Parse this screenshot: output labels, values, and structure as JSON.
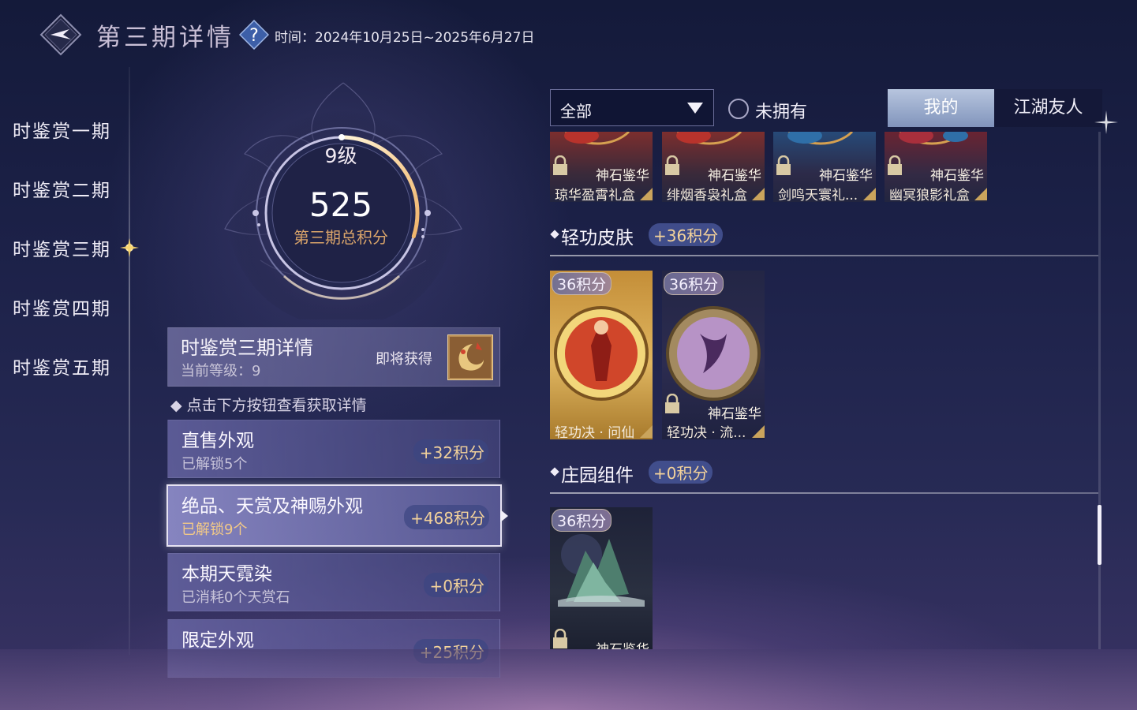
{
  "header": {
    "title": "第三期详情",
    "period_label": "时间：",
    "period_value": "2024年10月25日~2025年6月27日",
    "back_icon": "back-arrow-icon",
    "help_icon": "question-icon"
  },
  "sidebar": {
    "items": [
      {
        "label": "时鉴赏一期",
        "active": false
      },
      {
        "label": "时鉴赏二期",
        "active": false
      },
      {
        "label": "时鉴赏三期",
        "active": true
      },
      {
        "label": "时鉴赏四期",
        "active": false
      },
      {
        "label": "时鉴赏五期",
        "active": false
      }
    ]
  },
  "progress": {
    "level": "9级",
    "total_score": "525",
    "score_label": "第三期总积分",
    "ring_fill": 0.3
  },
  "detail": {
    "title": "时鉴赏三期详情",
    "current_level": "当前等级：9",
    "soon_label": "即将获得"
  },
  "hint": "点击下方按钮查看获取详情",
  "categories": [
    {
      "title": "直售外观",
      "subtitle": "已解锁5个",
      "points": "+32积分"
    },
    {
      "title": "绝品、天赏及神赐外观",
      "subtitle": "已解锁9个",
      "points": "+468积分"
    },
    {
      "title": "本期天霓染",
      "subtitle": "已消耗0个天赏石",
      "points": "+0积分"
    },
    {
      "title": "限定外观",
      "subtitle": "",
      "points": "+25积分"
    }
  ],
  "filters": {
    "select_value": "全部",
    "radio_label": "未拥有",
    "radio_checked": false
  },
  "tabs": {
    "mine": "我的",
    "friends": "江湖友人",
    "active": "mine"
  },
  "top_items": [
    {
      "tag": "神石鉴华",
      "name": "琼华盈霄礼盒"
    },
    {
      "tag": "神石鉴华",
      "name": "绯烟香袅礼盒"
    },
    {
      "tag": "神石鉴华",
      "name": "剑鸣天寰礼..."
    },
    {
      "tag": "神石鉴华",
      "name": "幽冥狼影礼盒"
    }
  ],
  "sections": [
    {
      "title": "轻功皮肤",
      "badge": "+36积分",
      "items": [
        {
          "points": "36积分",
          "tag": "",
          "name": "轻功决 · 问仙",
          "locked": false
        },
        {
          "points": "36积分",
          "tag": "神石鉴华",
          "name": "轻功决 · 流...",
          "locked": true
        }
      ]
    },
    {
      "title": "庄园组件",
      "badge": "+0积分",
      "items": [
        {
          "points": "36积分",
          "tag": "神石鉴华",
          "name": "",
          "locked": true
        }
      ]
    }
  ],
  "colors": {
    "accent_gold": "#f3d29b",
    "panel": "#6e6eaf",
    "active_tab": "#a6b6d6"
  }
}
